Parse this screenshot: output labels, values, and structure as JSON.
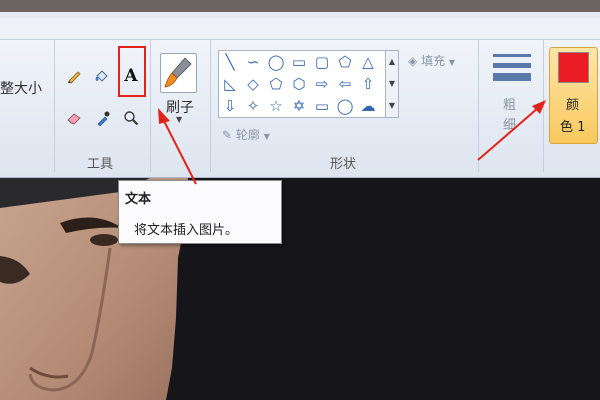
{
  "ribbon": {
    "image_group_label": "整大小",
    "tools_group_label": "工具",
    "brushes_label": "刷子",
    "shapes_group_label": "形状",
    "outline_label": "轮廓",
    "fill_label": "填充",
    "size_label_1": "粗",
    "size_label_2": "细",
    "color1_label_1": "颜",
    "color1_label_2": "色 1",
    "color1_value": "#ec1c24"
  },
  "tools": [
    "pencil-icon",
    "fill-bucket-icon",
    "text-icon",
    "eraser-icon",
    "color-picker-icon",
    "magnifier-icon"
  ],
  "shapes": [
    "line-icon",
    "curve-icon",
    "oval-icon",
    "rectangle-icon",
    "rounded-rectangle-icon",
    "triangle-icon",
    "right-triangle-icon",
    "diamond-icon",
    "pentagon-icon",
    "hexagon-icon",
    "right-arrow-icon",
    "left-arrow-icon",
    "up-arrow-icon",
    "down-arrow-icon",
    "four-point-star-icon",
    "five-point-star-icon",
    "six-point-star-icon",
    "rounded-callout-icon",
    "oval-callout-icon",
    "cloud-callout-icon"
  ],
  "text_tool_glyph": "A",
  "tooltip": {
    "title": "文本",
    "description": "将文本插入图片。"
  },
  "annotation_color": "#e2231a"
}
